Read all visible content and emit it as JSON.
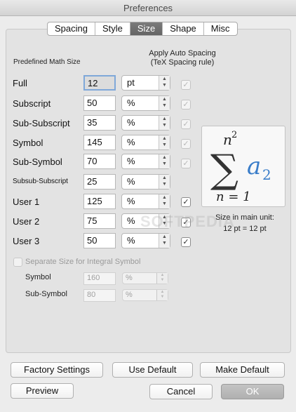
{
  "window": {
    "title": "Preferences"
  },
  "tabs": [
    {
      "label": "Spacing"
    },
    {
      "label": "Style"
    },
    {
      "label": "Size",
      "active": true
    },
    {
      "label": "Shape"
    },
    {
      "label": "Misc"
    }
  ],
  "headers": {
    "predefined": "Predefined Math Size",
    "apply_line1": "Apply Auto Spacing",
    "apply_line2": "(TeX Spacing rule)"
  },
  "rows": [
    {
      "label": "Full",
      "value": "12",
      "unit": "pt",
      "auto_spacing": true,
      "auto_enabled": false
    },
    {
      "label": "Subscript",
      "value": "50",
      "unit": "%",
      "auto_spacing": true,
      "auto_enabled": false
    },
    {
      "label": "Sub-Subscript",
      "value": "35",
      "unit": "%",
      "auto_spacing": true,
      "auto_enabled": false
    },
    {
      "label": "Symbol",
      "value": "145",
      "unit": "%",
      "auto_spacing": true,
      "auto_enabled": false
    },
    {
      "label": "Sub-Symbol",
      "value": "70",
      "unit": "%",
      "auto_spacing": true,
      "auto_enabled": false
    },
    {
      "label": "Subsub-Subscript",
      "value": "25",
      "unit": "%"
    },
    {
      "label": "User 1",
      "value": "125",
      "unit": "%",
      "auto_spacing": true,
      "auto_enabled": true
    },
    {
      "label": "User 2",
      "value": "75",
      "unit": "%",
      "auto_spacing": true,
      "auto_enabled": true
    },
    {
      "label": "User 3",
      "value": "50",
      "unit": "%",
      "auto_spacing": true,
      "auto_enabled": true
    }
  ],
  "preview": {
    "superscript": "n",
    "superscript_exp": "2",
    "sigma": "∑",
    "term": "a",
    "term_sub": "2",
    "lower": "n = 1",
    "term_color": "#3a7dc9"
  },
  "size_info": {
    "label": "Size in main unit:",
    "value": "12 pt = 12 pt"
  },
  "integral": {
    "checkbox_label": "Separate Size for Integral Symbol",
    "checked": false,
    "symbol_label": "Symbol",
    "symbol_value": "160",
    "symbol_unit": "%",
    "subsymbol_label": "Sub-Symbol",
    "subsymbol_value": "80",
    "subsymbol_unit": "%"
  },
  "buttons": {
    "factory": "Factory Settings",
    "use_default": "Use Default",
    "make_default": "Make Default",
    "preview": "Preview",
    "cancel": "Cancel",
    "ok": "OK"
  },
  "watermark": "SOFTPEDIA",
  "icons": {
    "stepper": "up-down-chevron-icon",
    "check": "checkmark-icon"
  }
}
